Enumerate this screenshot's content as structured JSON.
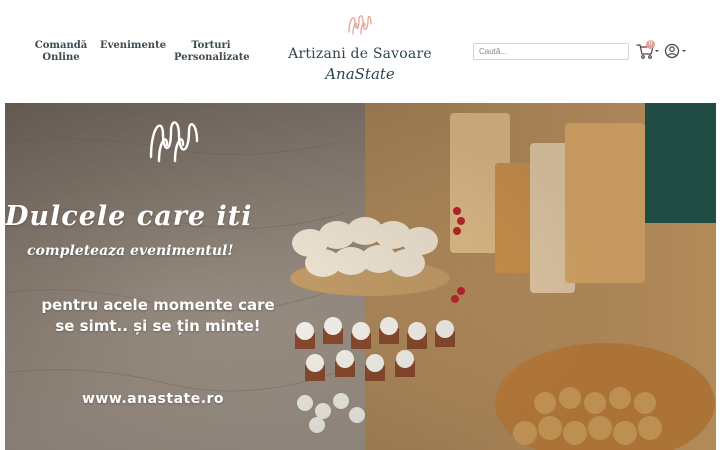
{
  "header": {
    "nav": {
      "comanda_line1": "Comandă",
      "comanda_line2": "Online",
      "evenimente": "Evenimente",
      "torturi_line1": "Torturi",
      "torturi_line2": "Personalizate"
    },
    "brand": {
      "name": "Artizani de Savoare",
      "script": "AnaState",
      "mark_icon": "anastate-monogram-icon"
    },
    "search": {
      "placeholder": "Caută..."
    },
    "cart": {
      "icon": "cart-icon",
      "count": "0"
    },
    "user": {
      "icon": "user-circle-icon"
    }
  },
  "hero": {
    "headline_line1": "Dulcele care iti",
    "headline_line2": "completeaza evenimentul!",
    "subtitle_line1": "pentru acele momente care",
    "subtitle_line2": "se simt.. și se țin minte!",
    "url": "www.anastate.ro",
    "logo_icon": "anastate-monogram-icon"
  },
  "colors": {
    "nav_text": "#3e4a50",
    "brand_text": "#2f4550",
    "brand_accent": "#e8a196",
    "hero_text": "#ffffff"
  }
}
